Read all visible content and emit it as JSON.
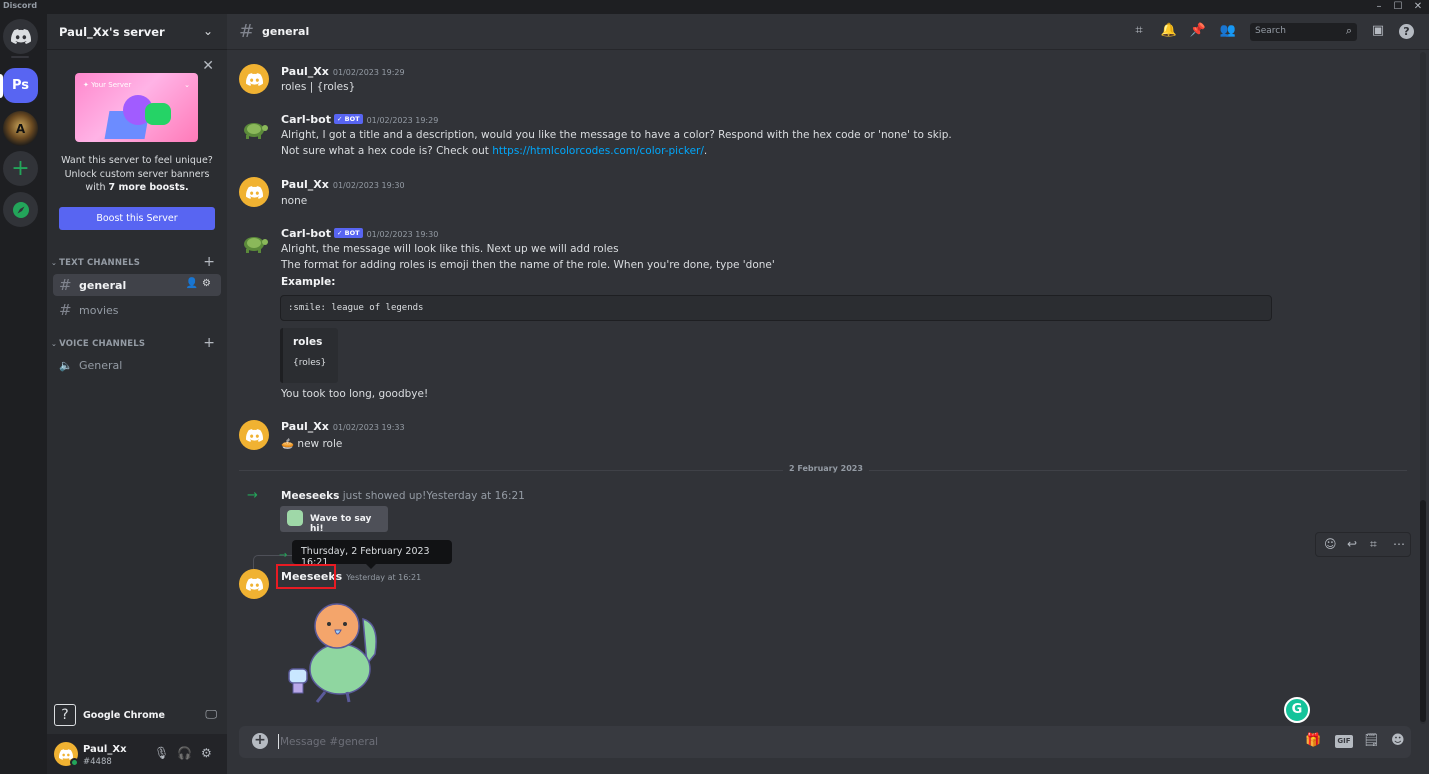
{
  "window": {
    "app_name": "Discord",
    "minimize": "–",
    "maximize": "☐",
    "close": "✕"
  },
  "rail": {
    "ps_label": "Ps",
    "lol_label": "A",
    "add_label": "+"
  },
  "server": {
    "name": "Paul_Xx's server",
    "chevron": "⌄",
    "boost_close": "✕",
    "boost_art_left": "✦ Your Server",
    "boost_art_right": "⌄",
    "boost_text_1": "Want this server to feel unique? Unlock custom server banners with ",
    "boost_text_bold": "7 more boosts.",
    "boost_button": "Boost this Server"
  },
  "categories": {
    "text": "TEXT CHANNELS",
    "voice": "VOICE CHANNELS",
    "caret": "⌄",
    "plus": "+"
  },
  "channels": [
    {
      "name": "general",
      "icon": "#"
    },
    {
      "name": "movies",
      "icon": "#"
    },
    {
      "name": "General",
      "icon": "🔈"
    }
  ],
  "channel_tools": "👤⚙",
  "activity": {
    "icon": "?",
    "name": "Google Chrome",
    "screen_icon": "🖵"
  },
  "user": {
    "name": "Paul_Xx",
    "tag": "#4488",
    "mic": "🎙",
    "headset": "🎧",
    "settings": "⚙"
  },
  "topbar": {
    "hash": "#",
    "channel": "general",
    "search_placeholder": "Search",
    "icons": {
      "threads": "⌗",
      "bell": "🔔",
      "pin": "📌",
      "members": "👥",
      "search": "⌕",
      "inbox": "▣",
      "help": "?"
    }
  },
  "messages": [
    {
      "author": "Paul_Xx",
      "time": "01/02/2023 19:29",
      "lines": [
        "roles | {roles}"
      ]
    },
    {
      "author": "Carl-bot",
      "badge": "✓ BOT",
      "time": "01/02/2023 19:29",
      "line1": "Alright, I got a title and a description, would you like the message to have a color? Respond with the hex code or 'none' to skip.",
      "line2_prefix": "Not sure what a hex code is? Check out ",
      "line2_link": "https://htmlcolorcodes.com/color-picker/",
      "line2_suffix": "."
    },
    {
      "author": "Paul_Xx",
      "time": "01/02/2023 19:30",
      "lines": [
        "none"
      ]
    },
    {
      "author": "Carl-bot",
      "badge": "✓ BOT",
      "time": "01/02/2023 19:30",
      "line1": "Alright, the message will look like this. Next up we will add roles",
      "line2": "The format for adding roles is emoji then the name of the role. When you're done, type 'done'",
      "line3": "Example:",
      "code": ":smile: league of legends",
      "embed_title": "roles",
      "embed_desc": "{roles}",
      "line4": "You took too long, goodbye!"
    },
    {
      "author": "Paul_Xx",
      "time": "01/02/2023 19:33",
      "emoji": "🥧",
      "text": "new role"
    }
  ],
  "divider": "2 February 2023",
  "join": {
    "arrow": "→",
    "name": "Meeseeks",
    "text": " just showed up!",
    "time": "Yesterday at 16:21",
    "wave": "Wave to say hi!"
  },
  "tooltip": "Thursday, 2 February 2023 16:21",
  "last_message": {
    "author": "Meeseeks",
    "time": "Yesterday at 16:21",
    "reply_arrow": "→"
  },
  "hover_toolbar": {
    "react": "☺",
    "reply": "↩",
    "thread": "⌗",
    "more": "⋯"
  },
  "composer": {
    "plus": "+",
    "placeholder": "Message #general",
    "gift": "🎁",
    "gif": "GIF",
    "sticker": "🗒",
    "emoji": "☻"
  },
  "grammarly": "G"
}
